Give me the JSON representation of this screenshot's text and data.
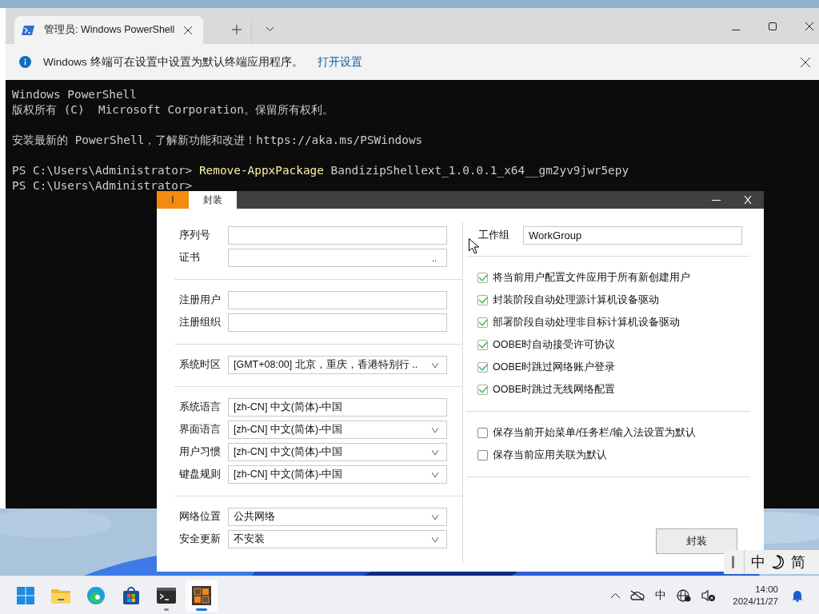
{
  "terminal": {
    "tabs": [
      {
        "title": "管理员: Windows PowerShell",
        "selected": true
      }
    ],
    "infobar": {
      "message": "Windows 终端可在设置中设置为默认终端应用程序。",
      "link": "打开设置"
    },
    "lines": [
      {
        "kind": "output",
        "text": "Windows PowerShell"
      },
      {
        "kind": "output",
        "text": "版权所有 (C)  Microsoft Corporation。保留所有权利。"
      },
      {
        "kind": "blank"
      },
      {
        "kind": "output",
        "text": "安装最新的 PowerShell，了解新功能和改进！https://aka.ms/PSWindows"
      },
      {
        "kind": "blank"
      },
      {
        "kind": "prompt",
        "prompt": "PS C:\\Users\\Administrator>",
        "command": "Remove-AppxPackage",
        "args": "BandizipShellext_1.0.0.1_x64__gm2yv9jwr5epy"
      },
      {
        "kind": "prompt",
        "prompt": "PS C:\\Users\\Administrator>"
      }
    ]
  },
  "dialog": {
    "tabs": [
      {
        "label": "I",
        "selected": false
      },
      {
        "label": "封装",
        "selected": true
      }
    ],
    "left_groups": [
      [
        {
          "label": "序列号",
          "kind": "text"
        },
        {
          "label": "证书",
          "kind": "browse",
          "button": ".."
        }
      ],
      [
        {
          "label": "注册用户",
          "kind": "text"
        },
        {
          "label": "注册组织",
          "kind": "text"
        }
      ],
      [
        {
          "label": "系统时区",
          "kind": "select",
          "value": "[GMT+08:00] 北京，重庆，香港特别行 .."
        }
      ],
      [
        {
          "label": "系统语言",
          "kind": "text",
          "value": "[zh-CN] 中文(简体)-中国"
        },
        {
          "label": "界面语言",
          "kind": "select",
          "value": "[zh-CN] 中文(简体)-中国"
        },
        {
          "label": "用户习惯",
          "kind": "select",
          "value": "[zh-CN] 中文(简体)-中国"
        },
        {
          "label": "键盘规则",
          "kind": "select",
          "value": "[zh-CN] 中文(简体)-中国"
        }
      ],
      [
        {
          "label": "网络位置",
          "kind": "select",
          "value": "公共网络"
        },
        {
          "label": "安全更新",
          "kind": "select",
          "value": "不安装"
        }
      ]
    ],
    "workgroup": {
      "label": "工作组",
      "value": "WorkGroup"
    },
    "check_groups": [
      [
        {
          "label": "将当前用户配置文件应用于所有新创建用户",
          "checked": true
        },
        {
          "label": "封装阶段自动处理源计算机设备驱动",
          "checked": true
        },
        {
          "label": "部署阶段自动处理非目标计算机设备驱动",
          "checked": true
        },
        {
          "label": "OOBE时自动接受许可协议",
          "checked": true
        },
        {
          "label": "OOBE时跳过网络账户登录",
          "checked": true
        },
        {
          "label": "OOBE时跳过无线网络配置",
          "checked": true
        }
      ],
      [
        {
          "label": "保存当前开始菜单/任务栏/输入法设置为默认",
          "checked": false
        },
        {
          "label": "保存当前应用关联为默认",
          "checked": false
        }
      ]
    ],
    "button": "封装"
  },
  "ime_bar": {
    "mode": "中",
    "charset": "简"
  },
  "taskbar": {
    "apps": [
      {
        "kind": "start",
        "running": false,
        "selected": false
      },
      {
        "kind": "explorer",
        "running": false,
        "selected": false
      },
      {
        "kind": "edge",
        "running": false,
        "selected": false
      },
      {
        "kind": "store",
        "running": false,
        "selected": false
      },
      {
        "kind": "terminal",
        "running": true,
        "selected": false
      },
      {
        "kind": "tool",
        "running": true,
        "selected": true
      }
    ],
    "ime": "中",
    "time": "14:00",
    "date": "2024/11/27"
  }
}
